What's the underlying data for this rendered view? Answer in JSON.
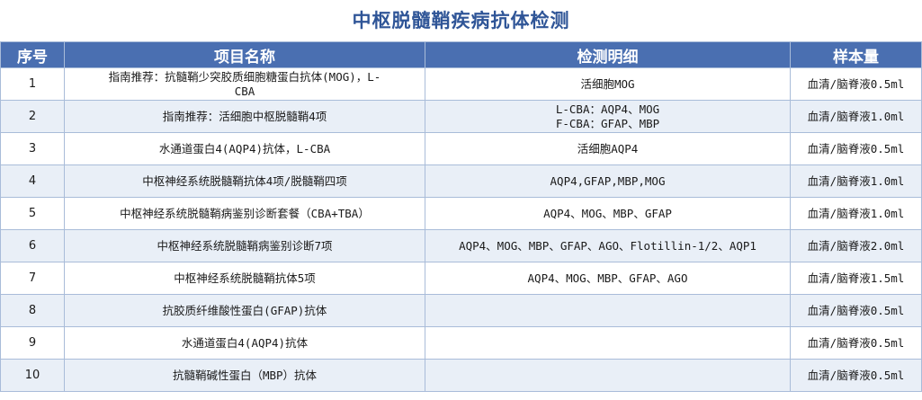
{
  "title": "中枢脱髓鞘疾病抗体检测",
  "headers": [
    "序号",
    "项目名称",
    "检测明细",
    "样本量"
  ],
  "rows": [
    {
      "no": "1",
      "name": "指南推荐：抗髓鞘少突胶质细胞糖蛋白抗体(MOG)，L-\nCBA",
      "detail": "活细胞MOG",
      "sample": "血清/脑脊液0.5ml"
    },
    {
      "no": "2",
      "name": "指南推荐：活细胞中枢脱髓鞘4项",
      "detail": "L-CBA：AQP4、MOG\nF-CBA：GFAP、MBP",
      "sample": "血清/脑脊液1.0ml"
    },
    {
      "no": "3",
      "name": "水通道蛋白4(AQP4)抗体，L-CBA",
      "detail": "活细胞AQP4",
      "sample": "血清/脑脊液0.5ml"
    },
    {
      "no": "4",
      "name": "中枢神经系统脱髓鞘抗体4项/脱髓鞘四项",
      "detail": "AQP4,GFAP,MBP,MOG",
      "sample": "血清/脑脊液1.0ml"
    },
    {
      "no": "5",
      "name": "中枢神经系统脱髓鞘病鉴别诊断套餐（CBA+TBA）",
      "detail": "AQP4、MOG、MBP、GFAP",
      "sample": "血清/脑脊液1.0ml"
    },
    {
      "no": "6",
      "name": "中枢神经系统脱髓鞘病鉴别诊断7项",
      "detail": "AQP4、MOG、MBP、GFAP、AGO、Flotillin-1/2、AQP1",
      "sample": "血清/脑脊液2.0ml"
    },
    {
      "no": "7",
      "name": "中枢神经系统脱髓鞘抗体5项",
      "detail": "AQP4、MOG、MBP、GFAP、AGO",
      "sample": "血清/脑脊液1.5ml"
    },
    {
      "no": "8",
      "name": "抗胶质纤维酸性蛋白(GFAP)抗体",
      "detail": "",
      "sample": "血清/脑脊液0.5ml"
    },
    {
      "no": "9",
      "name": "水通道蛋白4(AQP4)抗体",
      "detail": "",
      "sample": "血清/脑脊液0.5ml"
    },
    {
      "no": "10",
      "name": "抗髓鞘碱性蛋白（MBP）抗体",
      "detail": "",
      "sample": "血清/脑脊液0.5ml"
    }
  ],
  "colors": {
    "title": "#2f5597",
    "header_bg": "#4a6fb1",
    "alt_row_bg": "#e9eff7",
    "border": "#a9bcd9"
  }
}
